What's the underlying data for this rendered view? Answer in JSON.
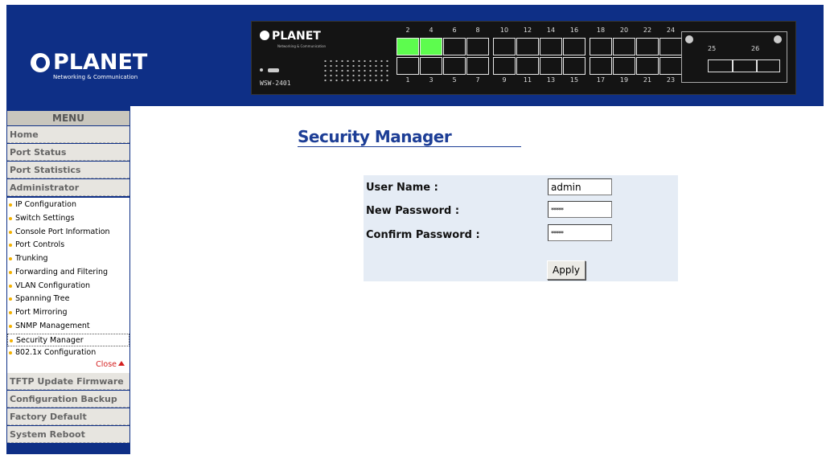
{
  "header": {
    "brand": "PLANET",
    "tagline": "Networking & Communication"
  },
  "switch_panel": {
    "brand": "PLANET",
    "tagline": "Networking & Communication",
    "model": "WSW-2401",
    "top_port_labels": [
      "2",
      "4",
      "6",
      "8",
      "10",
      "12",
      "14",
      "16",
      "18",
      "20",
      "22",
      "24"
    ],
    "bottom_port_labels": [
      "1",
      "3",
      "5",
      "7",
      "9",
      "11",
      "13",
      "15",
      "17",
      "19",
      "21",
      "23"
    ],
    "active_ports": [
      "2",
      "4"
    ],
    "sfp_labels": [
      "25",
      "26"
    ],
    "active_color": "#5dfc4e"
  },
  "sidebar": {
    "title": "MENU",
    "items": [
      {
        "label": "Home"
      },
      {
        "label": "Port Status"
      },
      {
        "label": "Port Statistics"
      },
      {
        "label": "Administrator"
      }
    ],
    "sub_items": [
      {
        "label": "IP Configuration"
      },
      {
        "label": "Switch Settings"
      },
      {
        "label": "Console Port Information"
      },
      {
        "label": "Port Controls"
      },
      {
        "label": "Trunking"
      },
      {
        "label": "Forwarding and Filtering"
      },
      {
        "label": "VLAN Configuration"
      },
      {
        "label": "Spanning Tree"
      },
      {
        "label": "Port Mirroring"
      },
      {
        "label": "SNMP Management"
      },
      {
        "label": "Security Manager"
      },
      {
        "label": "802.1x Configuration"
      }
    ],
    "selected_sub": "Security Manager",
    "close_label": "Close",
    "bottom_items": [
      {
        "label": "TFTP Update Firmware"
      },
      {
        "label": "Configuration Backup"
      },
      {
        "label": "Factory Default"
      },
      {
        "label": "System Reboot"
      }
    ]
  },
  "main": {
    "title": "Security Manager",
    "form": {
      "user_name_label": "User Name :",
      "user_name_value": "admin",
      "new_password_label": "New Password :",
      "new_password_value": "*****",
      "confirm_password_label": "Confirm Password :",
      "confirm_password_value": "*****",
      "apply_label": "Apply"
    }
  },
  "colors": {
    "header_bg": "#0e2f86",
    "title_color": "#1d3e96",
    "form_bg": "#e5ecf5"
  }
}
